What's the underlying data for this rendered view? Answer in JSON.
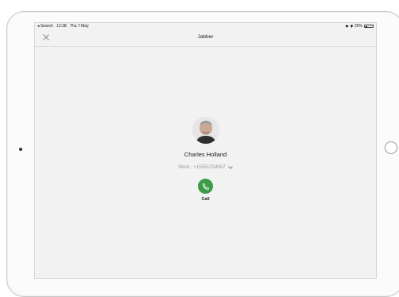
{
  "status_bar": {
    "back_app": "◂ Search",
    "time": "13:38",
    "date": "Thu 7 May",
    "battery": "25%",
    "battery_level": 0.25
  },
  "nav": {
    "title": "Jabber",
    "close_icon": "close-icon"
  },
  "contact": {
    "name": "Charles Holland",
    "number": "Work : +15551234567",
    "avatar_icon": "avatar"
  },
  "call": {
    "label": "Call",
    "icon": "phone-icon",
    "color": "#3d9b48"
  },
  "colors": {
    "screen_bg": "#f2f2f2",
    "accent_green": "#3d9b48"
  }
}
